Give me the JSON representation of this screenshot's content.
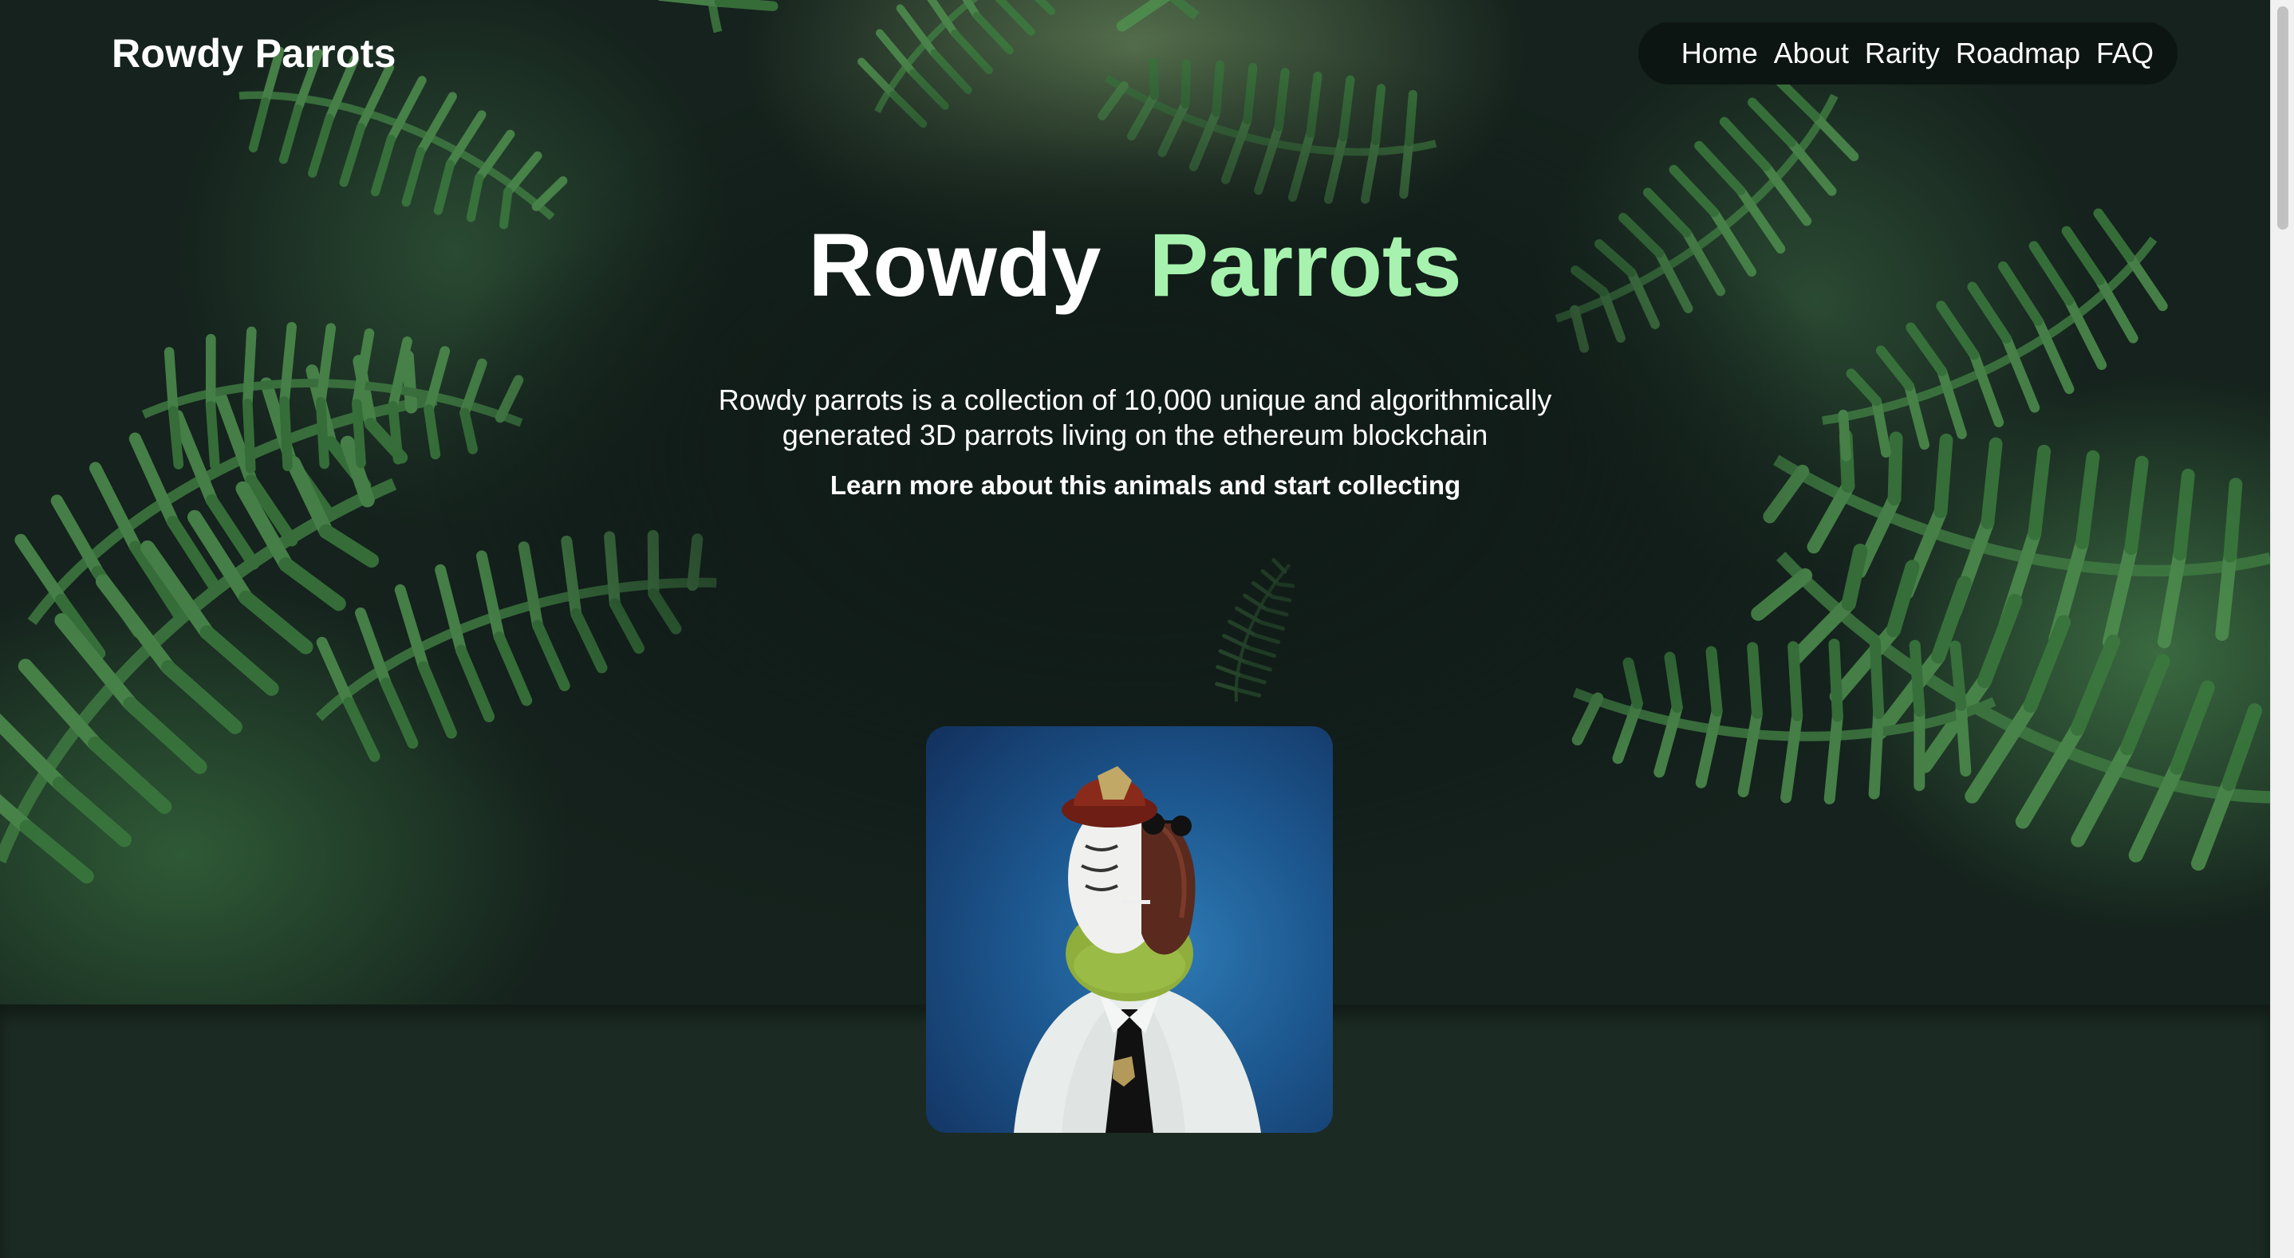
{
  "header": {
    "brand": "Rowdy Parrots",
    "nav": [
      "Home",
      "About",
      "Rarity",
      "Roadmap",
      "FAQ"
    ]
  },
  "hero": {
    "title_word1": "Rowdy",
    "title_word2": "Parrots",
    "description": "Rowdy parrots is a collection of 10,000 unique and algorithmically generated 3D parrots living on the ethereum blockchain",
    "cta": "Learn more about this animals and start collecting"
  },
  "colors": {
    "accent_green": "#a6f2ae",
    "nav_bg": "#0d1512",
    "lower_bg": "#1b2a23"
  },
  "icons": {
    "card_image": "parrot-nft-image"
  }
}
